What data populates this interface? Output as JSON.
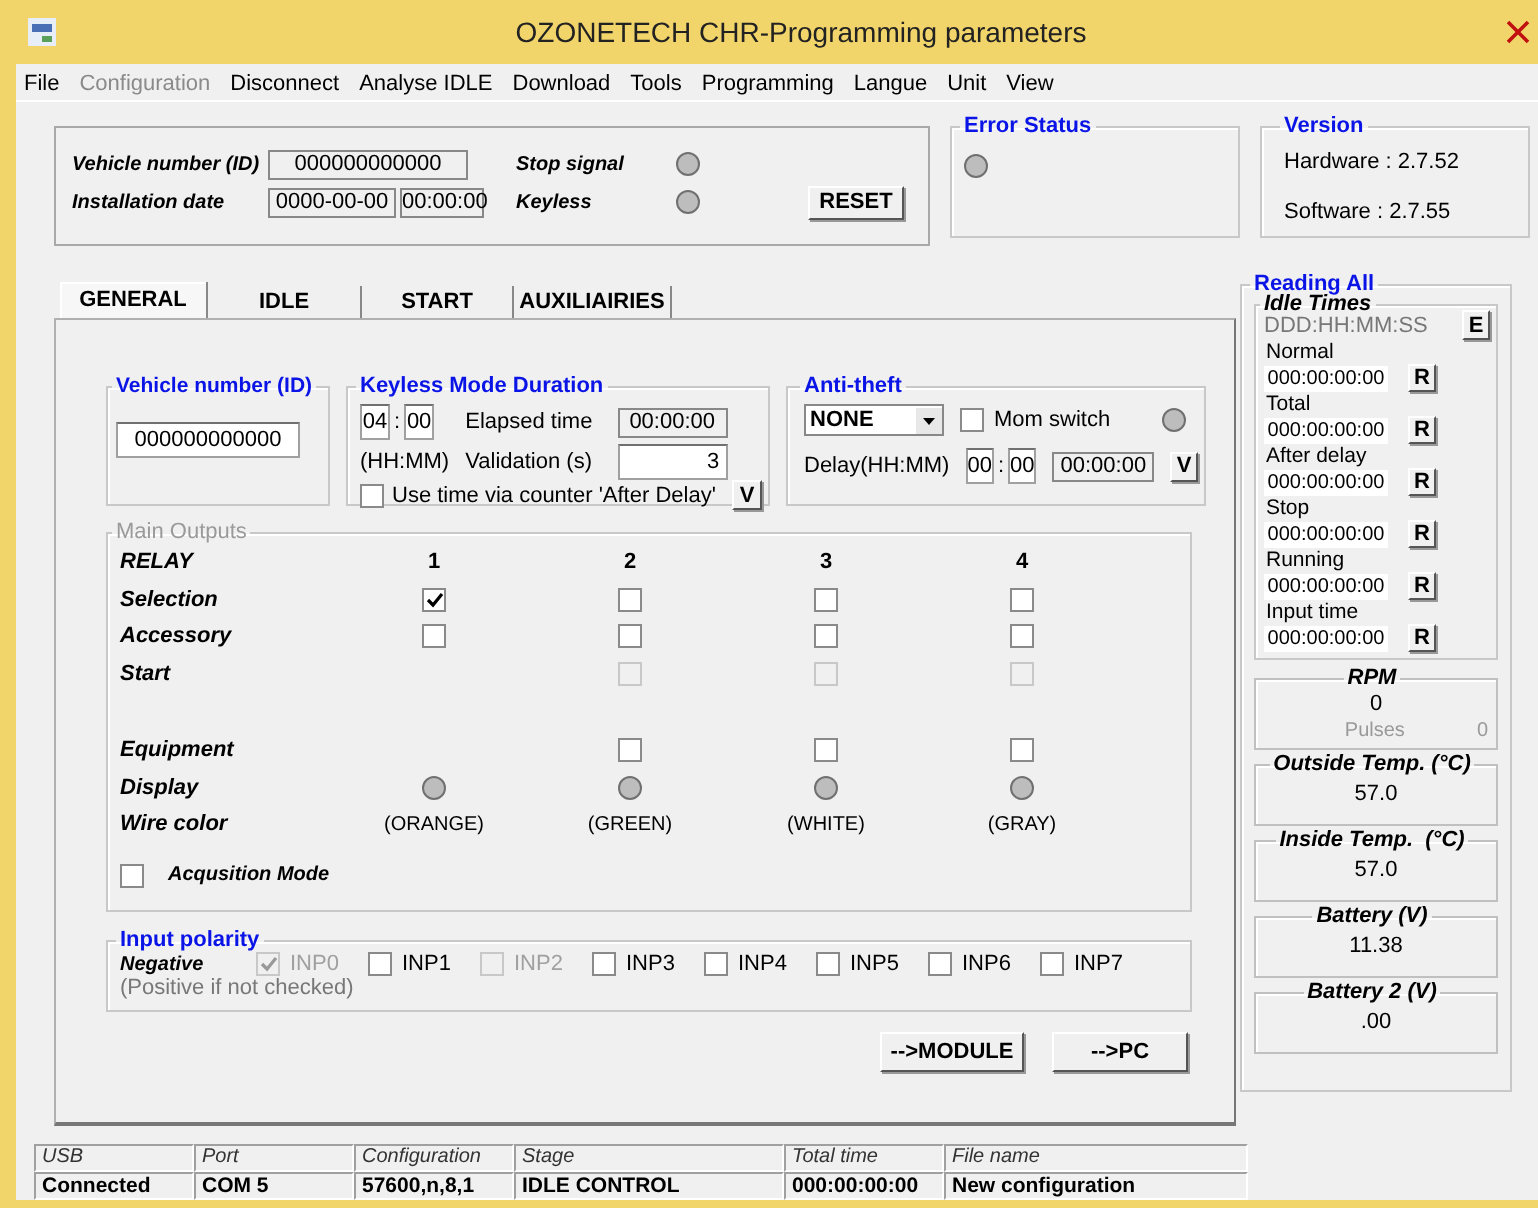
{
  "window": {
    "title": "OZONETECH CHR-Programming parameters"
  },
  "menu": [
    {
      "label": "File",
      "disabled": false
    },
    {
      "label": "Configuration",
      "disabled": true
    },
    {
      "label": "Disconnect",
      "disabled": false
    },
    {
      "label": "Analyse IDLE",
      "disabled": false
    },
    {
      "label": "Download",
      "disabled": false
    },
    {
      "label": "Tools",
      "disabled": false
    },
    {
      "label": "Programming",
      "disabled": false
    },
    {
      "label": "Langue",
      "disabled": false
    },
    {
      "label": "Unit",
      "disabled": false
    },
    {
      "label": "View",
      "disabled": false
    }
  ],
  "header": {
    "vehicle_label": "Vehicle number (ID)",
    "vehicle_value": "000000000000",
    "date_label": "Installation date",
    "date_value": "0000-00-00",
    "time_value": "00:00:00",
    "indicators": [
      {
        "label": "Stop signal",
        "on": false
      },
      {
        "label": "Keyless",
        "on": false
      }
    ],
    "reset_button": "RESET"
  },
  "error_status": {
    "title": "Error Status",
    "on": false
  },
  "version": {
    "title": "Version",
    "lines": [
      "Hardware : 2.7.52",
      "Software : 2.7.55"
    ]
  },
  "tabs": [
    {
      "label": "GENERAL",
      "selected": true
    },
    {
      "label": "IDLE",
      "selected": false
    },
    {
      "label": "START",
      "selected": false
    },
    {
      "label": "AUXILIAIRIES",
      "selected": false
    }
  ],
  "vehicle_group": {
    "title": "Vehicle number (ID)",
    "value": "000000000000"
  },
  "keyless": {
    "title": "Keyless Mode Duration",
    "hours": "04",
    "separator": ":",
    "minutes": "00",
    "format": "(HH:MM)",
    "elapsed_label": "Elapsed time",
    "elapsed_value": "00:00:00",
    "validation_label": "Validation (s)",
    "validation_value": "3",
    "counter_option": {
      "label": "Use time via counter 'After Delay'",
      "checked": false
    },
    "button": "V"
  },
  "anti_theft": {
    "title": "Anti-theft",
    "mode": "NONE",
    "mom_switch": {
      "label": "Mom switch",
      "checked": false
    },
    "on": false,
    "delay_label": "Delay(HH:MM)",
    "hours": "00",
    "separator": ":",
    "minutes": "00",
    "value": "00:00:00",
    "button": "V"
  },
  "main_outputs": {
    "title": "Main Outputs",
    "rows": [
      {
        "kind": "header",
        "label": "RELAY",
        "cells": [
          {
            "text": "1"
          },
          {
            "text": "2"
          },
          {
            "text": "3"
          },
          {
            "text": "4"
          }
        ]
      },
      {
        "kind": "checkbox",
        "label": "Selection",
        "cells": [
          {
            "kind": "check",
            "checked": true,
            "disabled": false
          },
          {
            "kind": "check",
            "checked": false,
            "disabled": false
          },
          {
            "kind": "check",
            "checked": false,
            "disabled": false
          },
          {
            "kind": "check",
            "checked": false,
            "disabled": false
          }
        ]
      },
      {
        "kind": "checkbox",
        "label": "Accessory",
        "cells": [
          {
            "kind": "check",
            "checked": false,
            "disabled": false
          },
          {
            "kind": "check",
            "checked": false,
            "disabled": false
          },
          {
            "kind": "check",
            "checked": false,
            "disabled": false
          },
          {
            "kind": "check",
            "checked": false,
            "disabled": false
          }
        ]
      },
      {
        "kind": "checkbox",
        "label": "Start",
        "cells": [
          {
            "kind": "empty"
          },
          {
            "kind": "check",
            "checked": false,
            "disabled": true
          },
          {
            "kind": "check",
            "checked": false,
            "disabled": true
          },
          {
            "kind": "check",
            "checked": false,
            "disabled": true
          }
        ]
      },
      {
        "kind": "checkbox",
        "label": "Equipment",
        "cells": [
          {
            "kind": "empty"
          },
          {
            "kind": "check",
            "checked": false,
            "disabled": false
          },
          {
            "kind": "check",
            "checked": false,
            "disabled": false
          },
          {
            "kind": "check",
            "checked": false,
            "disabled": false
          }
        ]
      },
      {
        "kind": "led",
        "label": "Display",
        "cells": [
          {
            "on": false
          },
          {
            "on": false
          },
          {
            "on": false
          },
          {
            "on": false
          }
        ]
      },
      {
        "kind": "text",
        "label": "Wire color",
        "cells": [
          {
            "text": "(ORANGE)"
          },
          {
            "text": "(GREEN)"
          },
          {
            "text": "(WHITE)"
          },
          {
            "text": "(GRAY)"
          }
        ]
      }
    ],
    "acquisition": {
      "label": "Acqusition Mode",
      "checked": false
    }
  },
  "input_polarity": {
    "title": "Input polarity",
    "label": "Negative",
    "hint": "(Positive if not checked)",
    "inputs": [
      {
        "label": "INP0",
        "checked": true,
        "disabled": true
      },
      {
        "label": "INP1",
        "checked": false,
        "disabled": false
      },
      {
        "label": "INP2",
        "checked": false,
        "disabled": true
      },
      {
        "label": "INP3",
        "checked": false,
        "disabled": false
      },
      {
        "label": "INP4",
        "checked": false,
        "disabled": false
      },
      {
        "label": "INP5",
        "checked": false,
        "disabled": false
      },
      {
        "label": "INP6",
        "checked": false,
        "disabled": false
      },
      {
        "label": "INP7",
        "checked": false,
        "disabled": false
      }
    ]
  },
  "actions": [
    "-->MODULE",
    "-->PC"
  ],
  "reading": {
    "title": "Reading All",
    "idle_times": {
      "title": "Idle Times",
      "format": "DDD:HH:MM:SS",
      "edit_button": "E",
      "counters": [
        {
          "label": "Normal",
          "value": "000:00:00:00",
          "button": "R"
        },
        {
          "label": "Total",
          "value": "000:00:00:00",
          "button": "R"
        },
        {
          "label": "After delay",
          "value": "000:00:00:00",
          "button": "R"
        },
        {
          "label": "Stop",
          "value": "000:00:00:00",
          "button": "R"
        },
        {
          "label": "Running",
          "value": "000:00:00:00",
          "button": "R"
        },
        {
          "label": "Input time",
          "value": "000:00:00:00",
          "button": "R"
        }
      ]
    },
    "rpm": {
      "title": "RPM",
      "value": "0",
      "pulses_label": "Pulses",
      "pulses_value": "0"
    },
    "gauges": [
      {
        "title": "Outside Temp. (°C)",
        "value": "57.0"
      },
      {
        "title": "Inside Temp.  (°C)",
        "value": "57.0"
      },
      {
        "title": "Battery (V)",
        "value": "11.38"
      },
      {
        "title": "Battery 2 (V)",
        "value": ".00"
      }
    ]
  },
  "status_bar": [
    {
      "header": "USB",
      "value": "Connected"
    },
    {
      "header": "Port",
      "value": "COM 5"
    },
    {
      "header": "Configuration",
      "value": "57600,n,8,1"
    },
    {
      "header": "Stage",
      "value": "IDLE CONTROL"
    },
    {
      "header": "Total time",
      "value": "000:00:00:00"
    },
    {
      "header": "File name",
      "value": "New configuration"
    }
  ]
}
